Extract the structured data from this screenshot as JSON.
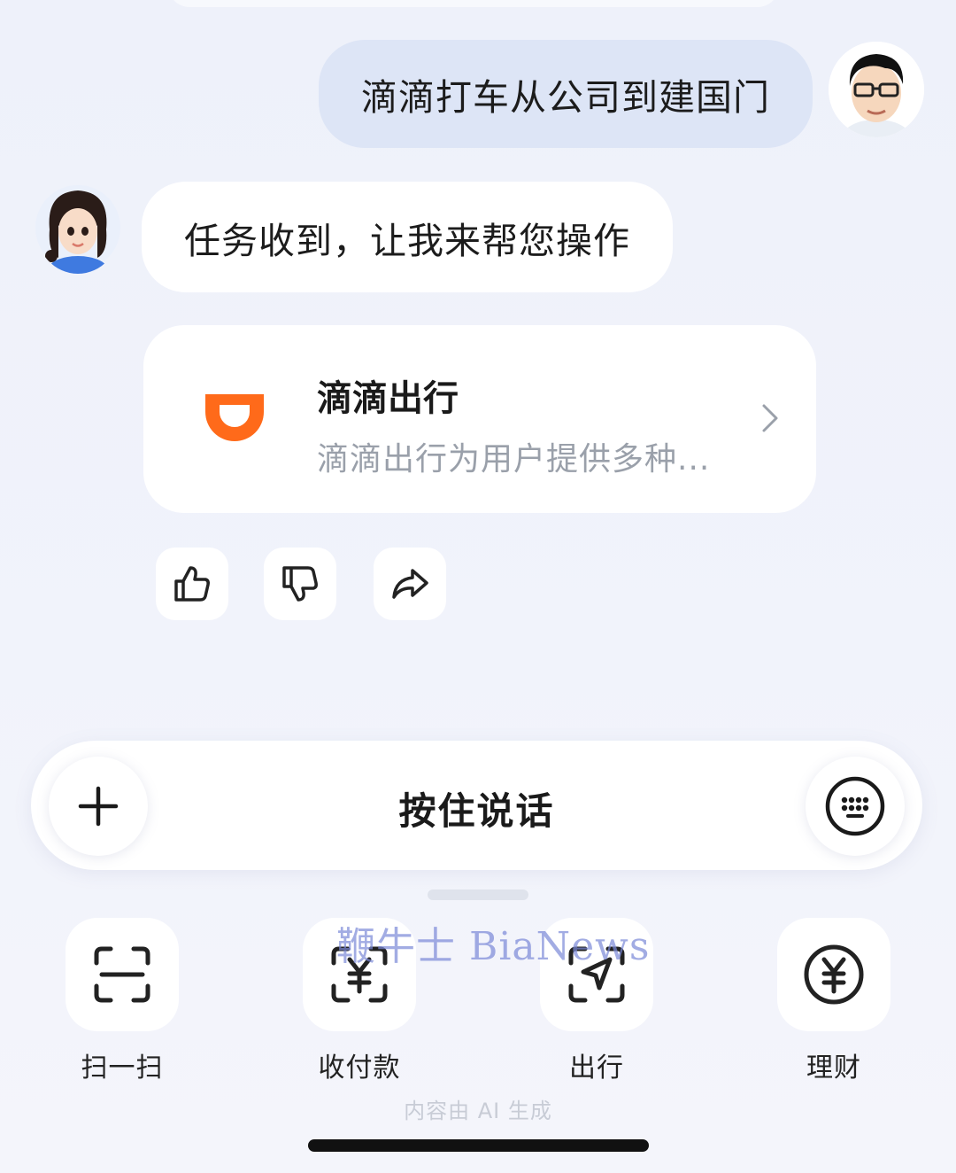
{
  "chat": {
    "user_message": "滴滴打车从公司到建国门",
    "ai_message": "任务收到，让我来帮您操作"
  },
  "app_card": {
    "title": "滴滴出行",
    "description": "滴滴出行为用户提供多种...",
    "brand_color": "#ff6a1a"
  },
  "reactions": [
    "thumbs-up-icon",
    "thumbs-down-icon",
    "share-icon"
  ],
  "input_bar": {
    "hold_to_talk_label": "按住说话"
  },
  "shortcuts": [
    {
      "label": "扫一扫",
      "icon": "scan-icon"
    },
    {
      "label": "收付款",
      "icon": "payment-icon"
    },
    {
      "label": "出行",
      "icon": "travel-icon"
    },
    {
      "label": "理财",
      "icon": "finance-icon"
    }
  ],
  "watermark": "鞭牛士 BiaNews",
  "ai_notice": "内容由 AI 生成"
}
